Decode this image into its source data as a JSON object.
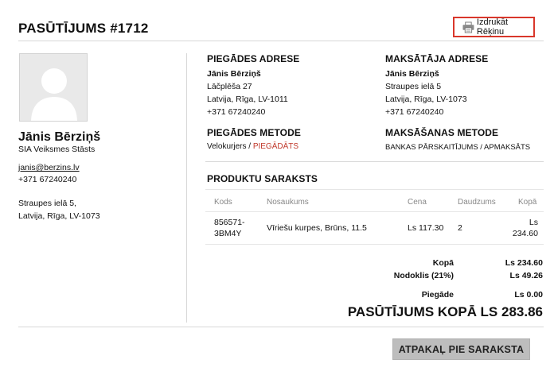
{
  "header": {
    "title": "PASŪTĪJUMS #1712",
    "print_label": "Izdrukāt Rēķinu"
  },
  "customer": {
    "name": "Jānis Bērziņš",
    "company": "SIA Veiksmes Stāsts",
    "email": "janis@berzins.lv",
    "phone": "+371 67240240",
    "address_line1": "Straupes ielā 5,",
    "address_line2": "Latvija, Rīga, LV-1073"
  },
  "shipping_address": {
    "heading": "PIEGĀDES ADRESE",
    "name": "Jānis Bērziņš",
    "street": "Lāčplēša 27",
    "city": "Latvija, Rīga, LV-1011",
    "phone": "+371 67240240"
  },
  "billing_address": {
    "heading": "MAKSĀTĀJA ADRESE",
    "name": "Jānis Bērziņš",
    "street": "Straupes ielā 5",
    "city": "Latvija, Rīga, LV-1073",
    "phone": "+371 67240240"
  },
  "shipping_method": {
    "heading": "PIEGĀDES METODE",
    "method": "Velokurjers",
    "separator": " / ",
    "status": "PIEGĀDĀTS"
  },
  "payment_method": {
    "heading": "MAKSĀŠANAS METODE",
    "method": "BANKAS PĀRSKAITĪJUMS / APMAKSĀTS"
  },
  "products": {
    "heading": "PRODUKTU SARAKSTS",
    "columns": [
      "Kods",
      "Nosaukums",
      "Cena",
      "Daudzums",
      "Kopā"
    ],
    "rows": [
      {
        "code_line1": "856571-",
        "code_line2": "3BM4Y",
        "name": "Vīriešu kurpes, Brūns, 11.5",
        "price": "Ls 117.30",
        "qty": "2",
        "total_line1": "Ls",
        "total_line2": "234.60"
      }
    ]
  },
  "totals": {
    "subtotal_label": "Kopā",
    "subtotal": "Ls 234.60",
    "tax_label": "Nodoklis (21%)",
    "tax": "Ls 49.26",
    "shipping_label": "Piegāde",
    "shipping": "Ls 0.00",
    "grand_label": "PASŪTĪJUMS KOPĀ",
    "grand": "LS 283.86"
  },
  "actions": {
    "back_label": "ATPAKAĻ PIE SARAKSTA"
  },
  "colors": {
    "accent_red": "#c0392b",
    "print_border": "#d9372b",
    "button_gray": "#bdbdbd"
  },
  "icons": {
    "print": "printer-icon",
    "avatar": "user-placeholder-icon"
  }
}
